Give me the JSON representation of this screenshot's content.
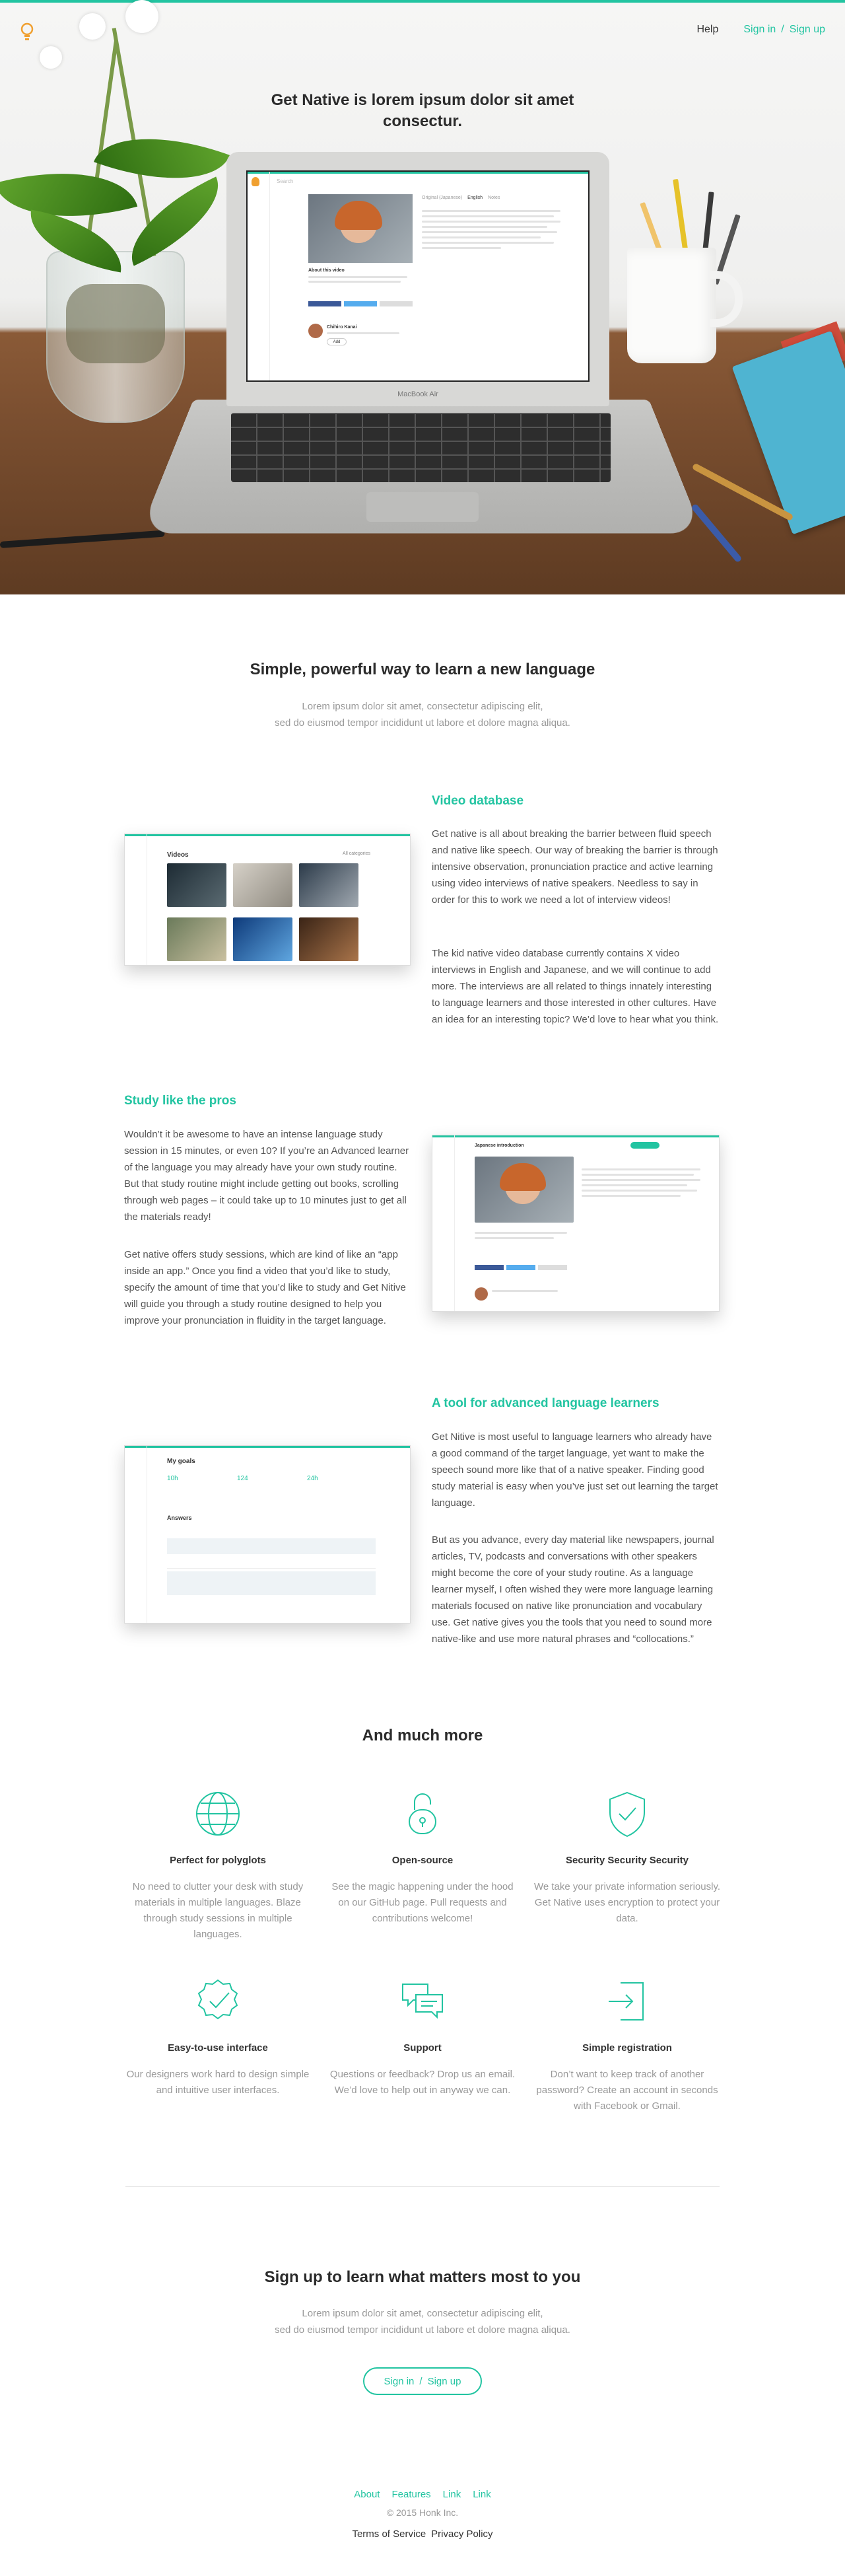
{
  "colors": {
    "accent": "#22c4a1",
    "text": "#333333",
    "muted": "#999999"
  },
  "header": {
    "logo_icon": "lightbulb-icon",
    "help": "Help",
    "sign_in": "Sign in",
    "separator": "/",
    "sign_up": "Sign up"
  },
  "hero": {
    "title": "Get Native is lorem ipsum dolor sit amet consectur.",
    "laptop_brand": "MacBook Air",
    "screen": {
      "search_placeholder": "Search",
      "tabs": [
        "Original (Japanese)",
        "English",
        "Notes"
      ],
      "video_title": "About this video",
      "user_name": "Chihiro Kanai",
      "add_button": "Add"
    }
  },
  "intro": {
    "title": "Simple, powerful way to learn a new language",
    "text_line1": "Lorem ipsum dolor sit amet, consectetur adipiscing elit,",
    "text_line2": "sed do eiusmod tempor incididunt ut labore et dolore magna aliqua."
  },
  "features": {
    "video_db": {
      "title": "Video database",
      "p1": "Get native is all about breaking the barrier between fluid speech and native like speech. Our way of breaking the barrier is through intensive observation, pronunciation practice and active learning using video interviews of native speakers. Needless to say in order for this to work we need a lot of interview videos!",
      "p2": "The kid native video database currently contains X video interviews in English and Japanese, and we will continue to add more. The interviews are all related to things innately interesting to language learners and those interested in other cultures. Have an idea for an interesting topic? We’d love to hear what you think.",
      "mock_title": "Videos",
      "mock_filter": "All categories"
    },
    "study": {
      "title": "Study like the pros",
      "p1": "Wouldn’t it be awesome to have an intense language study session in 15 minutes, or even 10? If you’re an Advanced learner of the language you may already have your own study routine. But that study routine might include getting out books, scrolling through web pages – it could take up to 10 minutes just to get all the materials ready!",
      "p2": "Get native offers study sessions, which are kind of like an “app inside an app.” Once you find a video that you’d like to study, specify the amount of time that you’d like to study and Get Nitive will guide you through a study routine designed to help you improve your pronunciation in fluidity in the target language.",
      "mock_title": "Japanese introduction"
    },
    "advanced": {
      "title": "A tool for advanced language learners",
      "p1": "Get Nitive is most useful to language learners who already have a good command of the target language, yet want to make the speech sound more like that of a native speaker. Finding good study material is easy when you’ve just set out learning the target language.",
      "p2": "But as you advance, every day material like newspapers, journal articles, TV, podcasts and conversations with other speakers might become the core of your study routine. As a language learner myself, I often wished they were more language learning materials focused on native like pronunciation and vocabulary use. Get native gives you the tools that you need to sound more native-like and use more natural phrases and “collocations.”",
      "mock_title": "My goals",
      "mock_stats": [
        "10h",
        "124",
        "24h"
      ],
      "mock_answers": "Answers"
    }
  },
  "more": {
    "title": "And much more",
    "items": [
      {
        "icon": "globe-icon",
        "title": "Perfect for polyglots",
        "text": "No need to clutter your desk with study materials in multiple languages. Blaze through study sessions in multiple languages."
      },
      {
        "icon": "open-lock-icon",
        "title": "Open-source",
        "text": "See the magic happening under the hood on our GitHub page. Pull requests and contributions welcome!"
      },
      {
        "icon": "shield-check-icon",
        "title": "Security Security Security",
        "text": "We take your private information seriously. Get Native uses encryption to protect your data."
      },
      {
        "icon": "badge-check-icon",
        "title": "Easy-to-use interface",
        "text": "Our designers work hard to design simple and intuitive user interfaces."
      },
      {
        "icon": "chat-bubbles-icon",
        "title": "Support",
        "text": "Questions or feedback? Drop us an email. We’d love to help out in anyway we can."
      },
      {
        "icon": "sign-in-icon",
        "title": "Simple registration",
        "text": "Don’t want to keep track of another password? Create an account in seconds with Facebook or Gmail."
      }
    ]
  },
  "cta": {
    "title": "Sign up to learn what matters most to you",
    "text_line1": "Lorem ipsum dolor sit amet, consectetur adipiscing elit,",
    "text_line2": "sed do eiusmod tempor incididunt ut labore et dolore magna aliqua.",
    "sign_in": "Sign in",
    "separator": "/",
    "sign_up": "Sign up"
  },
  "footer": {
    "links": [
      "About",
      "Features",
      "Link",
      "Link"
    ],
    "copyright": "© 2015 Honk Inc.",
    "terms": "Terms of Service",
    "privacy": "Privacy Policy"
  }
}
